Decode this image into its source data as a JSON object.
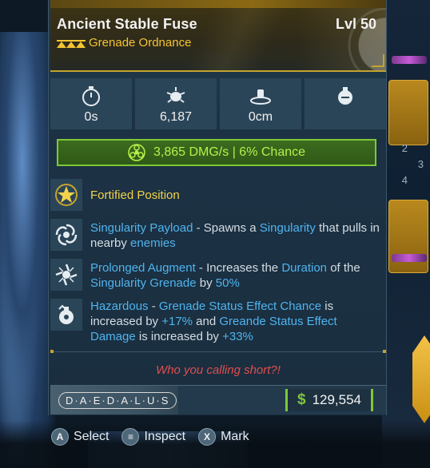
{
  "item": {
    "name": "Ancient Stable Fuse",
    "level": "Lvl 50",
    "type": "Grenade Ordnance",
    "rarity_color": "#f5c531"
  },
  "stats": [
    {
      "icon": "timer-icon",
      "value": "0s"
    },
    {
      "icon": "damage-burst-icon",
      "value": "6,187"
    },
    {
      "icon": "radius-icon",
      "value": "0cm"
    },
    {
      "icon": "grenade-count-icon",
      "value": ""
    }
  ],
  "element": {
    "icon": "corrosive-icon",
    "text": "3,865 DMG/s | 6% Chance",
    "color": "#7fc83a"
  },
  "perks": [
    {
      "icon": "star-badge-icon",
      "title": "Fortified Position"
    },
    {
      "icon": "singularity-icon",
      "name": "Singularity Payload",
      "t1": " - Spawns a ",
      "k1": "Singularity",
      "t2": " that pulls in nearby ",
      "k2": "enemies"
    },
    {
      "icon": "augment-swirl-icon",
      "name": "Prolonged Augment",
      "t1": " - Increases the ",
      "k1": "Duration",
      "t2": " of the ",
      "k2": "Singularity Grenade",
      "t3": " by ",
      "k3": "50%"
    },
    {
      "icon": "hazard-icon",
      "name": "Hazardous",
      "t1": " - ",
      "k1": "Grenade Status Effect Chance",
      "t2": " is increased by ",
      "k2": "+17%",
      "t3": " and ",
      "k3": "Greande Status Effect Damage",
      "t4": " is increased by ",
      "k4": "+33%"
    }
  ],
  "flavor_text": "Who you calling short?!",
  "manufacturer": "D·A·E·D·A·L·U·S",
  "price": {
    "symbol": "$",
    "value": "129,554"
  },
  "prompts": [
    {
      "button": "A",
      "label": "Select"
    },
    {
      "button": "≡",
      "label": "Inspect"
    },
    {
      "button": "X",
      "label": "Mark"
    }
  ],
  "side_slots": [
    "2",
    "3",
    "4"
  ]
}
